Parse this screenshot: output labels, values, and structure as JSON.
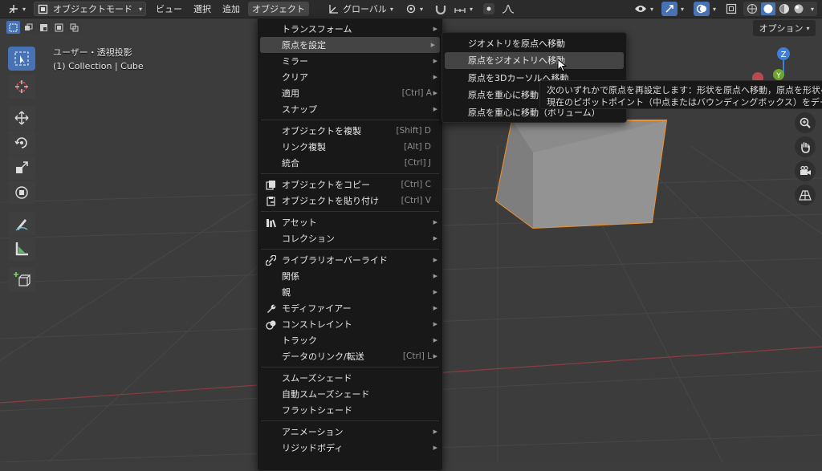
{
  "header": {
    "mode_label": "オブジェクトモード",
    "menus": [
      "ビュー",
      "選択",
      "追加",
      "オブジェクト"
    ],
    "transform_orientation": "グローバル"
  },
  "options_label": "オプション",
  "viewport_info": {
    "view_name": "ユーザー・透視投影",
    "collection": "(1) Collection | Cube"
  },
  "gizmo": {
    "z_label": "Z",
    "y_label": "Y"
  },
  "object_menu": {
    "groups": [
      [
        {
          "label": "トランスフォーム",
          "submenu": true
        },
        {
          "label": "原点を設定",
          "submenu": true,
          "highlighted": true
        },
        {
          "label": "ミラー",
          "submenu": true
        },
        {
          "label": "クリア",
          "submenu": true
        },
        {
          "label": "適用",
          "shortcut": "[Ctrl] A",
          "submenu": true
        },
        {
          "label": "スナップ",
          "submenu": true
        }
      ],
      [
        {
          "label": "オブジェクトを複製",
          "shortcut": "[Shift] D"
        },
        {
          "label": "リンク複製",
          "shortcut": "[Alt] D"
        },
        {
          "label": "統合",
          "shortcut": "[Ctrl] J"
        }
      ],
      [
        {
          "label": "オブジェクトをコピー",
          "shortcut": "[Ctrl] C",
          "icon": "copy-icon"
        },
        {
          "label": "オブジェクトを貼り付け",
          "shortcut": "[Ctrl] V",
          "icon": "paste-icon"
        }
      ],
      [
        {
          "label": "アセット",
          "submenu": true,
          "icon": "asset-icon"
        },
        {
          "label": "コレクション",
          "submenu": true
        }
      ],
      [
        {
          "label": "ライブラリオーバーライド",
          "submenu": true,
          "icon": "library-override-icon"
        },
        {
          "label": "関係",
          "submenu": true
        },
        {
          "label": "親",
          "submenu": true
        },
        {
          "label": "モディファイアー",
          "submenu": true,
          "icon": "wrench-icon"
        },
        {
          "label": "コンストレイント",
          "submenu": true,
          "icon": "constraint-icon"
        },
        {
          "label": "トラック",
          "submenu": true
        },
        {
          "label": "データのリンク/転送",
          "shortcut": "[Ctrl] L",
          "submenu": true
        }
      ],
      [
        {
          "label": "スムーズシェード"
        },
        {
          "label": "自動スムーズシェード"
        },
        {
          "label": "フラットシェード"
        }
      ],
      [
        {
          "label": "アニメーション",
          "submenu": true
        },
        {
          "label": "リジッドボディ",
          "submenu": true
        }
      ]
    ]
  },
  "origin_submenu": [
    {
      "label": "ジオメトリを原点へ移動"
    },
    {
      "label": "原点をジオメトリへ移動",
      "highlighted": true
    },
    {
      "label": "原点を3Dカーソルへ移動"
    },
    {
      "label": "原点を重心に移動（サーフェス）"
    },
    {
      "label": "原点を重心に移動（ボリューム）"
    }
  ],
  "tooltip": {
    "line1": "次のいずれかで原点を再設定します：形状を原点へ移動，原点を形状へ移動",
    "line2": "現在のピボットポイント（中点またはバウンディングボックス）をデータの原点に設定"
  },
  "colors": {
    "accent": "#4772b3",
    "selection_outline": "#f0902a",
    "x_axis": "#b84a52",
    "gizmo_z": "#3d7fd9",
    "gizmo_y": "#6da32e"
  }
}
